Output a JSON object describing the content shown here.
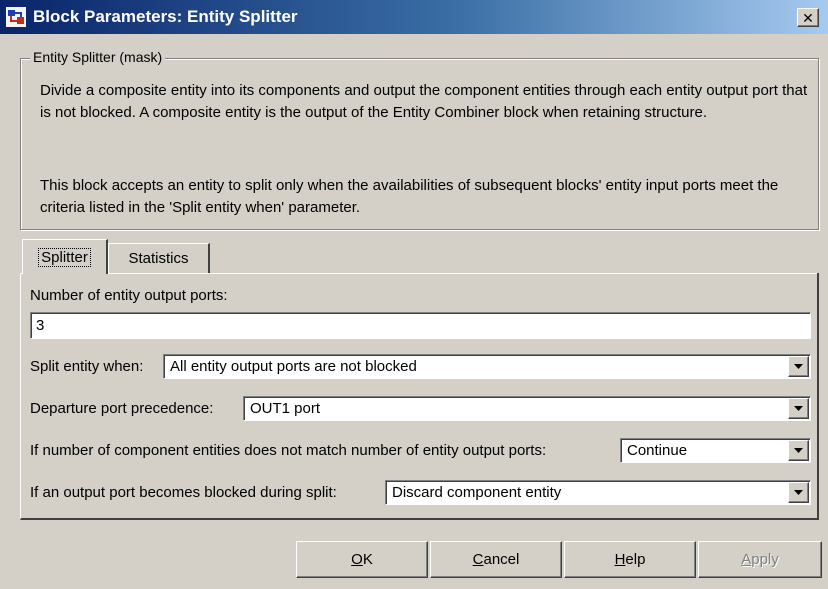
{
  "window": {
    "title": "Block Parameters: Entity Splitter",
    "close_label": "✕"
  },
  "mask": {
    "group_title": "Entity Splitter (mask)",
    "description_1": "Divide a composite entity into its components and output the component entities through each entity output port that is not blocked. A composite entity is the output of the Entity Combiner block when retaining structure.",
    "description_2": "This block accepts an entity to split only when the availabilities of subsequent blocks' entity input ports meet the criteria listed in the 'Split entity when' parameter."
  },
  "tabs": [
    {
      "label": "Splitter",
      "selected": true
    },
    {
      "label": "Statistics",
      "selected": false
    }
  ],
  "params": {
    "num_ports_label": "Number of entity output ports:",
    "num_ports_value": "3",
    "split_when_label": "Split entity when:",
    "split_when_value": "All entity output ports are not blocked",
    "departure_label": "Departure port precedence:",
    "departure_value": "OUT1 port",
    "mismatch_label": "If number of component entities does not match number of entity output ports:",
    "mismatch_value": "Continue",
    "blocked_label": "If an output port becomes blocked during split:",
    "blocked_value": "Discard component entity"
  },
  "buttons": {
    "ok": {
      "mnemonic": "O",
      "rest": "K"
    },
    "cancel": {
      "mnemonic": "C",
      "rest": "ancel"
    },
    "help": {
      "mnemonic": "H",
      "rest": "elp"
    },
    "apply": {
      "mnemonic": "A",
      "rest": "pply"
    }
  },
  "colors": {
    "title_gradient_start": "#0a246a",
    "title_gradient_end": "#a6caf0",
    "face": "#d4d0c8"
  }
}
